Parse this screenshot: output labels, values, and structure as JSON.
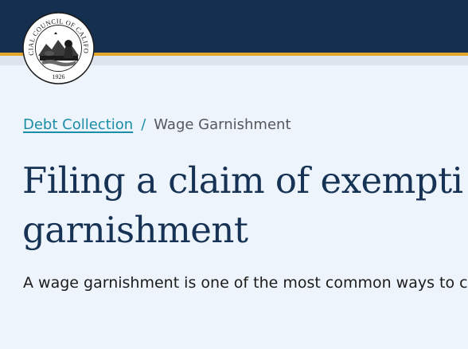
{
  "header": {
    "logo": {
      "icon": "judicial-council-seal-icon",
      "ring_text": "JUDICIAL COUNCIL OF CALIFORNIA",
      "year": "1926"
    },
    "colors": {
      "navy": "#152f51",
      "gold": "#e2a72a",
      "link": "#1a8ea6"
    }
  },
  "breadcrumb": {
    "parent_label": "Debt Collection",
    "separator": "/",
    "current_label": "Wage Garnishment"
  },
  "main": {
    "title": "Filing a claim of exempti\ngarnishment",
    "intro": "A wage garnishment is one of the most common ways to coll"
  }
}
